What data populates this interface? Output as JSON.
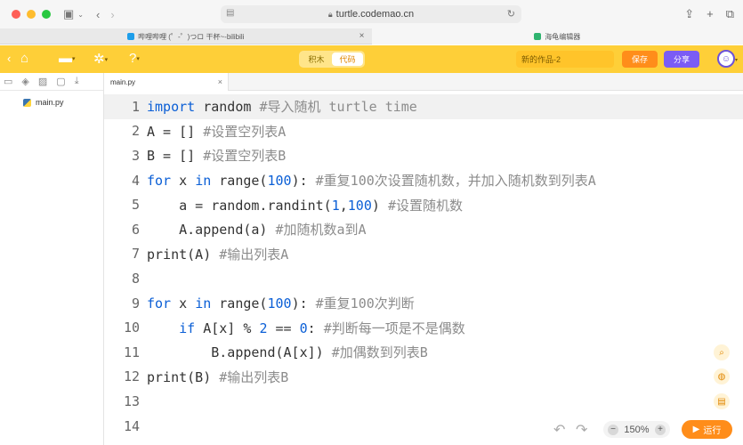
{
  "browser": {
    "url": "turtle.codemao.cn",
    "tabs": [
      {
        "title": "哔哩哔哩 (゜-゜)つロ 干杯~-bilibili",
        "active": false,
        "favicon_color": "#1e9eea"
      },
      {
        "title": "海龟编辑器",
        "active": true,
        "favicon_color": "#2fb36f"
      }
    ]
  },
  "app": {
    "mode_tabs": {
      "blocks": "积木",
      "code": "代码",
      "selected": "code"
    },
    "project_name": "新的作品-2",
    "save_label": "保存",
    "share_label": "分享",
    "brand_color": "#fecf38"
  },
  "sidebar": {
    "files": [
      {
        "name": "main.py"
      }
    ]
  },
  "editor": {
    "tab": "main.py",
    "current_line": 1,
    "lines": [
      {
        "n": "1",
        "tokens": [
          {
            "t": "import",
            "c": "kw"
          },
          {
            "t": " random ",
            "c": "fn"
          },
          {
            "t": "#导入随机 turtle time",
            "c": "cm"
          }
        ]
      },
      {
        "n": "2",
        "tokens": [
          {
            "t": "A = [] ",
            "c": "fn"
          },
          {
            "t": "#设置空列表A",
            "c": "cm"
          }
        ]
      },
      {
        "n": "3",
        "tokens": [
          {
            "t": "B = [] ",
            "c": "fn"
          },
          {
            "t": "#设置空列表B",
            "c": "cm"
          }
        ]
      },
      {
        "n": "4",
        "tokens": [
          {
            "t": "for",
            "c": "kw"
          },
          {
            "t": " x ",
            "c": "fn"
          },
          {
            "t": "in",
            "c": "kw"
          },
          {
            "t": " range(",
            "c": "fn"
          },
          {
            "t": "100",
            "c": "num"
          },
          {
            "t": "): ",
            "c": "fn"
          },
          {
            "t": "#重复100次设置随机数，并加入随机数到列表A",
            "c": "cm"
          }
        ]
      },
      {
        "n": "5",
        "tokens": [
          {
            "t": "    a = random.randint(",
            "c": "fn"
          },
          {
            "t": "1",
            "c": "num"
          },
          {
            "t": ",",
            "c": "fn"
          },
          {
            "t": "100",
            "c": "num"
          },
          {
            "t": ") ",
            "c": "fn"
          },
          {
            "t": "#设置随机数",
            "c": "cm"
          }
        ]
      },
      {
        "n": "6",
        "tokens": [
          {
            "t": "    A.append(a) ",
            "c": "fn"
          },
          {
            "t": "#加随机数a到A",
            "c": "cm"
          }
        ]
      },
      {
        "n": "7",
        "tokens": [
          {
            "t": "print(A) ",
            "c": "fn"
          },
          {
            "t": "#输出列表A",
            "c": "cm"
          }
        ]
      },
      {
        "n": "8",
        "tokens": []
      },
      {
        "n": "9",
        "tokens": [
          {
            "t": "for",
            "c": "kw"
          },
          {
            "t": " x ",
            "c": "fn"
          },
          {
            "t": "in",
            "c": "kw"
          },
          {
            "t": " range(",
            "c": "fn"
          },
          {
            "t": "100",
            "c": "num"
          },
          {
            "t": "): ",
            "c": "fn"
          },
          {
            "t": "#重复100次判断",
            "c": "cm"
          }
        ]
      },
      {
        "n": "10",
        "tokens": [
          {
            "t": "    ",
            "c": "fn"
          },
          {
            "t": "if",
            "c": "kw"
          },
          {
            "t": " A[x] % ",
            "c": "fn"
          },
          {
            "t": "2",
            "c": "num"
          },
          {
            "t": " == ",
            "c": "fn"
          },
          {
            "t": "0",
            "c": "num"
          },
          {
            "t": ": ",
            "c": "fn"
          },
          {
            "t": "#判断每一项是不是偶数",
            "c": "cm"
          }
        ]
      },
      {
        "n": "11",
        "tokens": [
          {
            "t": "        B.append(A[x]) ",
            "c": "fn"
          },
          {
            "t": "#加偶数到列表B",
            "c": "cm"
          }
        ]
      },
      {
        "n": "12",
        "tokens": [
          {
            "t": "print(B) ",
            "c": "fn"
          },
          {
            "t": "#输出列表B",
            "c": "cm"
          }
        ]
      },
      {
        "n": "13",
        "tokens": []
      },
      {
        "n": "14",
        "tokens": []
      }
    ]
  },
  "bottom": {
    "zoom": "150%",
    "run_label": "运行"
  },
  "icons": {
    "home": "home-icon",
    "folder": "folder-icon",
    "settings": "gear-icon",
    "help": "help-icon",
    "search": "search-icon",
    "palette": "palette-icon",
    "console": "console-icon",
    "undo": "undo-icon",
    "redo": "redo-icon",
    "play": "play-icon"
  }
}
